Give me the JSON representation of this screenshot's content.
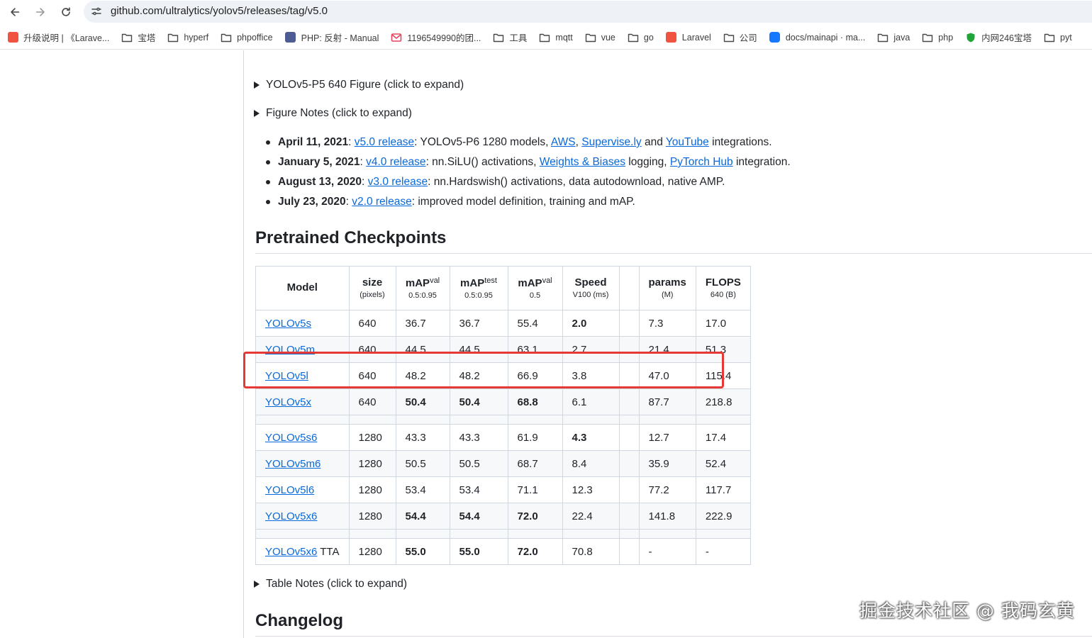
{
  "browser": {
    "url": "github.com/ultralytics/yolov5/releases/tag/v5.0"
  },
  "bookmarks": [
    {
      "label": "升级说明 | 《Larave...",
      "icon": "laravel-favicon"
    },
    {
      "label": "宝塔",
      "icon": "folder-icon"
    },
    {
      "label": "hyperf",
      "icon": "folder-icon"
    },
    {
      "label": "phpoffice",
      "icon": "folder-icon"
    },
    {
      "label": "PHP: 反射 - Manual",
      "icon": "php-favicon"
    },
    {
      "label": "1196549990的团...",
      "icon": "mail-favicon"
    },
    {
      "label": "工具",
      "icon": "folder-icon"
    },
    {
      "label": "mqtt",
      "icon": "folder-icon"
    },
    {
      "label": "vue",
      "icon": "folder-icon"
    },
    {
      "label": "go",
      "icon": "folder-icon"
    },
    {
      "label": "Laravel",
      "icon": "laravel-favicon"
    },
    {
      "label": "公司",
      "icon": "folder-icon"
    },
    {
      "label": "docs/mainapi · ma...",
      "icon": "docs-favicon"
    },
    {
      "label": "java",
      "icon": "folder-icon"
    },
    {
      "label": "php",
      "icon": "folder-icon"
    },
    {
      "label": "内网246宝塔",
      "icon": "shield-favicon"
    },
    {
      "label": "pyt",
      "icon": "folder-icon"
    }
  ],
  "details": {
    "figure": "YOLOv5-P5 640 Figure (click to expand)",
    "figure_notes": "Figure Notes (click to expand)",
    "table_notes": "Table Notes (click to expand)"
  },
  "news": [
    {
      "date": "April 11, 2021",
      "link": "v5.0 release",
      "parts": [
        ": ",
        ": YOLOv5-P6 1280 models, ",
        "AWS",
        ", ",
        "Supervise.ly",
        " and ",
        "YouTube",
        " integrations."
      ]
    },
    {
      "date": "January 5, 2021",
      "link": "v4.0 release",
      "parts": [
        ": ",
        ": nn.SiLU() activations, ",
        "Weights & Biases",
        " logging, ",
        "PyTorch Hub",
        " integration."
      ]
    },
    {
      "date": "August 13, 2020",
      "link": "v3.0 release",
      "text": ": nn.Hardswish() activations, data autodownload, native AMP."
    },
    {
      "date": "July 23, 2020",
      "link": "v2.0 release",
      "text": ": improved model definition, training and mAP."
    }
  ],
  "headings": {
    "checkpoints": "Pretrained Checkpoints",
    "changelog": "Changelog"
  },
  "table": {
    "headers": [
      {
        "main": "Model",
        "sub": ""
      },
      {
        "main": "size",
        "sub": "(pixels)"
      },
      {
        "main": "mAP",
        "sup": "val",
        "sub": "0.5:0.95"
      },
      {
        "main": "mAP",
        "sup": "test",
        "sub": "0.5:0.95"
      },
      {
        "main": "mAP",
        "sup": "val",
        "sub": "0.5"
      },
      {
        "main": "Speed",
        "sub": "V100 (ms)"
      },
      {
        "main": "",
        "sub": ""
      },
      {
        "main": "params",
        "sub": "(M)"
      },
      {
        "main": "FLOPS",
        "sub": "640 (B)"
      }
    ],
    "rows": [
      {
        "model": "YOLOv5s",
        "suffix": "",
        "cells": [
          "640",
          "36.7",
          "36.7",
          "55.4",
          "2.0",
          "",
          "7.3",
          "17.0"
        ],
        "bold": [
          4
        ]
      },
      {
        "model": "YOLOv5m",
        "suffix": "",
        "cells": [
          "640",
          "44.5",
          "44.5",
          "63.1",
          "2.7",
          "",
          "21.4",
          "51.3"
        ],
        "bold": []
      },
      {
        "model": "YOLOv5l",
        "suffix": "",
        "cells": [
          "640",
          "48.2",
          "48.2",
          "66.9",
          "3.8",
          "",
          "47.0",
          "115.4"
        ],
        "bold": []
      },
      {
        "model": "YOLOv5x",
        "suffix": "",
        "cells": [
          "640",
          "50.4",
          "50.4",
          "68.8",
          "6.1",
          "",
          "87.7",
          "218.8"
        ],
        "bold": [
          1,
          2,
          3
        ]
      },
      {
        "gap": true
      },
      {
        "model": "YOLOv5s6",
        "suffix": "",
        "cells": [
          "1280",
          "43.3",
          "43.3",
          "61.9",
          "4.3",
          "",
          "12.7",
          "17.4"
        ],
        "bold": [
          4
        ]
      },
      {
        "model": "YOLOv5m6",
        "suffix": "",
        "cells": [
          "1280",
          "50.5",
          "50.5",
          "68.7",
          "8.4",
          "",
          "35.9",
          "52.4"
        ],
        "bold": []
      },
      {
        "model": "YOLOv5l6",
        "suffix": "",
        "cells": [
          "1280",
          "53.4",
          "53.4",
          "71.1",
          "12.3",
          "",
          "77.2",
          "117.7"
        ],
        "bold": []
      },
      {
        "model": "YOLOv5x6",
        "suffix": "",
        "cells": [
          "1280",
          "54.4",
          "54.4",
          "72.0",
          "22.4",
          "",
          "141.8",
          "222.9"
        ],
        "bold": [
          1,
          2,
          3
        ]
      },
      {
        "gap": true
      },
      {
        "model": "YOLOv5x6",
        "suffix": " TTA",
        "cells": [
          "1280",
          "55.0",
          "55.0",
          "72.0",
          "70.8",
          "",
          "-",
          "-"
        ],
        "bold": [
          1,
          2,
          3
        ]
      }
    ]
  },
  "watermark": "掘金技术社区 @ 我码玄黄",
  "colors": {
    "link": "#0969da",
    "highlight": "#e53935"
  }
}
